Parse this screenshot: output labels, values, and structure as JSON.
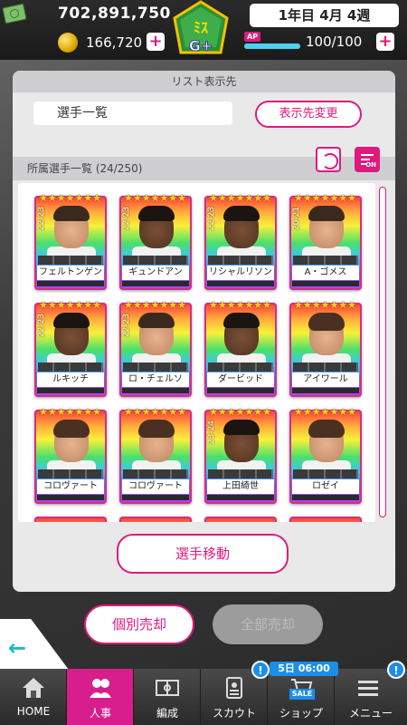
{
  "header": {
    "money": "702,891,750",
    "coins": "166,720",
    "date": "1年目 4月 4週",
    "ap_label": "AP",
    "ap_value": "100/100",
    "ap_fraction": 1.0,
    "plus": "+",
    "logo_text": "G+"
  },
  "list_dest": {
    "section_title": "リスト表示先",
    "current": "選手一覧",
    "change_label": "表示先変更"
  },
  "roster": {
    "section_title": "所属選手一覧 (24/250)",
    "filter_on": "ON",
    "cards": [
      {
        "name": "フェルトンゲン",
        "season": "22-23",
        "stars": "★★★★★★★"
      },
      {
        "name": "ギュンドアン",
        "season": "22-23",
        "stars": "★★★★★★★"
      },
      {
        "name": "リシャルリソン",
        "season": "22-23",
        "stars": "★★★★★★★"
      },
      {
        "name": "A・ゴメス",
        "season": "20-21",
        "stars": "★★★★★★★"
      },
      {
        "name": "ルキッチ",
        "season": "22-23",
        "stars": "★★★★★★★"
      },
      {
        "name": "ロ・チェルソ",
        "season": "22-23",
        "stars": "★★★★★★★"
      },
      {
        "name": "ダービッド",
        "season": "",
        "stars": "★★★★★★★"
      },
      {
        "name": "アイワール",
        "season": "",
        "stars": "★★★★★★★"
      },
      {
        "name": "コロヴァート",
        "season": "",
        "stars": "★★★★★★★"
      },
      {
        "name": "コロヴァート",
        "season": "",
        "stars": "★★★★★★★"
      },
      {
        "name": "上田綺世",
        "season": "23-24",
        "stars": "★★★★★★★"
      },
      {
        "name": "ロゼイ",
        "season": "",
        "stars": "★★★★★★★"
      }
    ],
    "move_label": "選手移動"
  },
  "actions": {
    "sell_single": "個別売却",
    "sell_all": "全部売却"
  },
  "back_arrow": "←",
  "nav": {
    "items": [
      {
        "label": "HOME",
        "icon": "home-icon"
      },
      {
        "label": "人事",
        "icon": "people-icon"
      },
      {
        "label": "編成",
        "icon": "pitch-icon"
      },
      {
        "label": "スカウト",
        "icon": "scout-card-icon"
      },
      {
        "label": "ショップ",
        "icon": "shop-cart-icon"
      },
      {
        "label": "メニュー",
        "icon": "menu-icon"
      }
    ],
    "badge": "!",
    "timer": "5日 06:00",
    "sale": "SALE"
  },
  "colors": {
    "accent": "#e0197d",
    "active_nav": "#d81e8c",
    "badge": "#1a8fe8"
  }
}
